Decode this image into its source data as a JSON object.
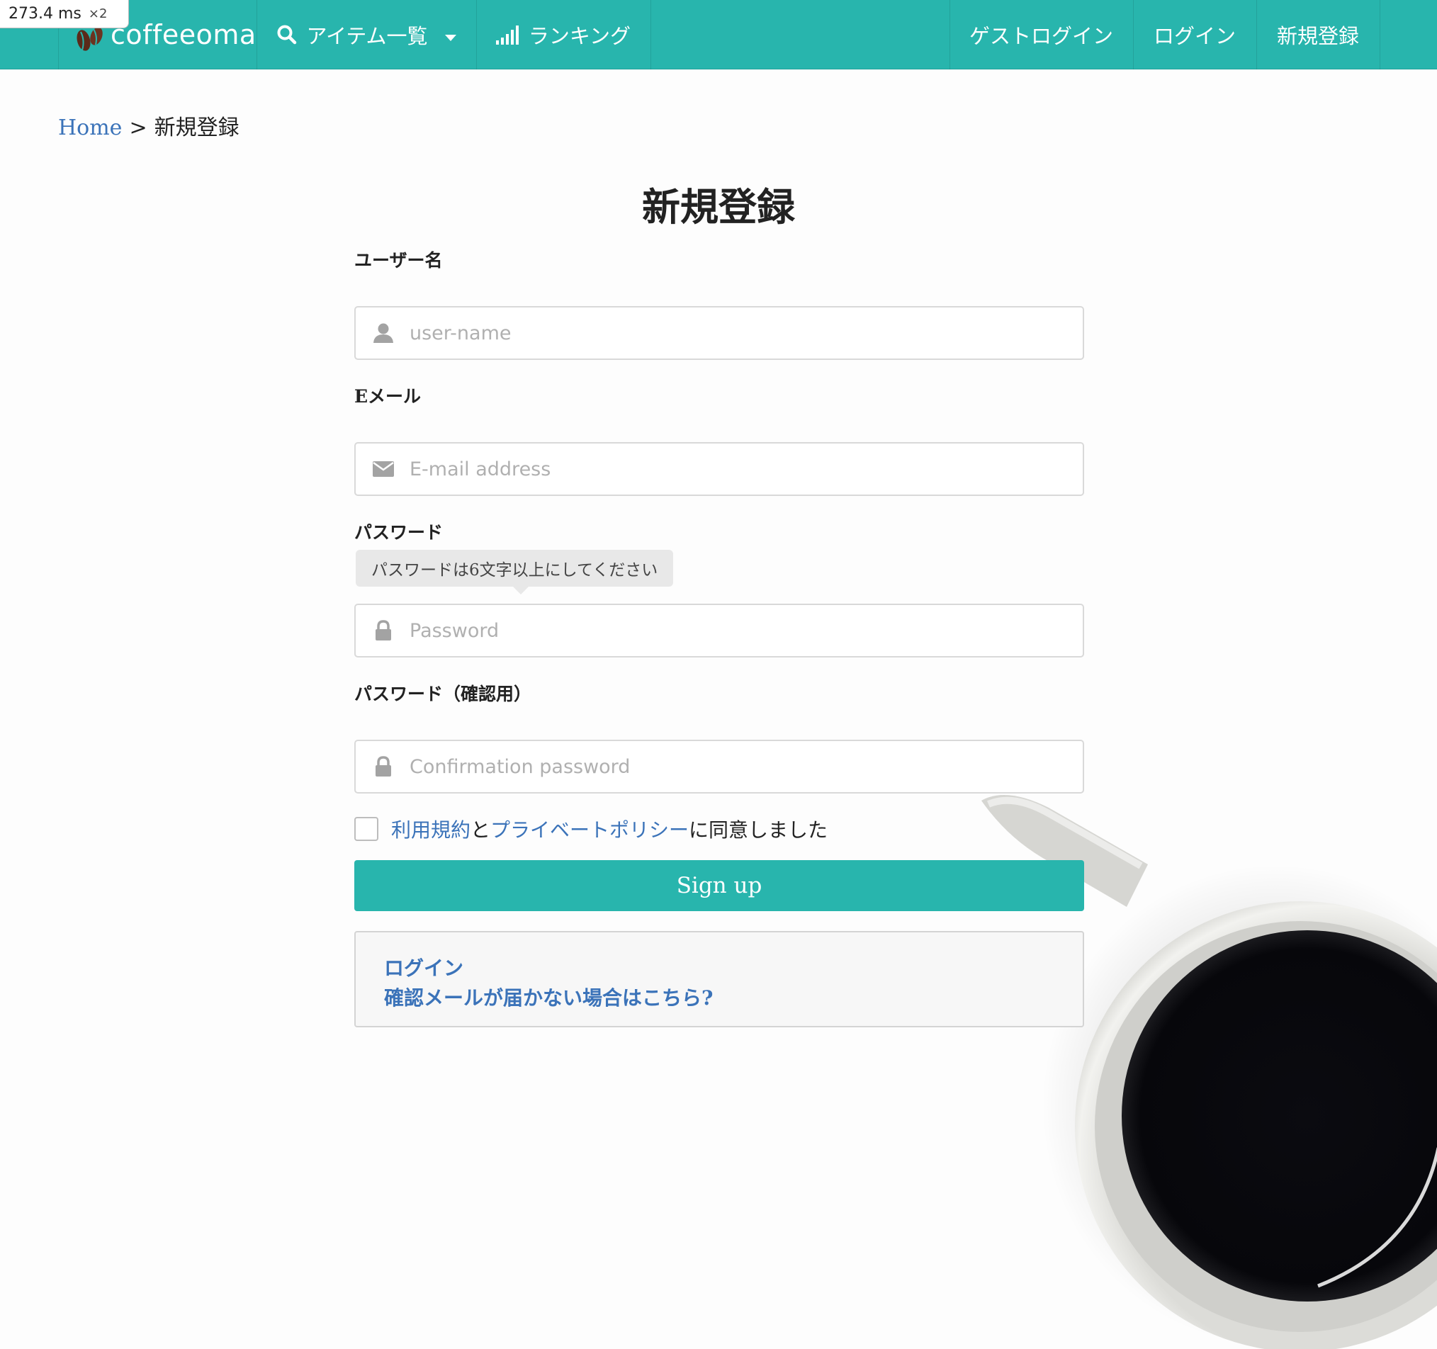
{
  "perf": {
    "time": "273.4 ms",
    "multiplier": "×2"
  },
  "nav": {
    "brand": "coffeeoma",
    "items_dropdown": "アイテム一覧",
    "ranking": "ランキング",
    "guest_login": "ゲストログイン",
    "login": "ログイン",
    "signup": "新規登録"
  },
  "breadcrumb": {
    "home": "Home",
    "separator": ">",
    "current": "新規登録"
  },
  "form": {
    "title": "新規登録",
    "username_label": "ユーザー名",
    "username_placeholder": "user-name",
    "email_label": "Eメール",
    "email_placeholder": "E-mail address",
    "password_label": "パスワード",
    "password_hint": "パスワードは6文字以上にしてください",
    "password_placeholder": "Password",
    "confirm_label": "パスワード（確認用）",
    "confirm_placeholder": "Confirmation password",
    "agree": {
      "terms": "利用規約",
      "and": "と",
      "privacy": "プライベートポリシー",
      "suffix": "に同意しました",
      "checked": false
    },
    "submit": "Sign up"
  },
  "help_links": {
    "login": "ログイン",
    "resend_confirmation": "確認メールが届かない場合はこちら?"
  },
  "colors": {
    "brand": "#28b5ad",
    "link": "#3b73b9"
  },
  "icons": {
    "search": "search-icon",
    "caret": "caret-down-icon",
    "ranking": "signal-bars-icon",
    "user": "user-icon",
    "email": "envelope-icon",
    "password": "lock-icon",
    "logo": "coffee-bean-logo"
  }
}
